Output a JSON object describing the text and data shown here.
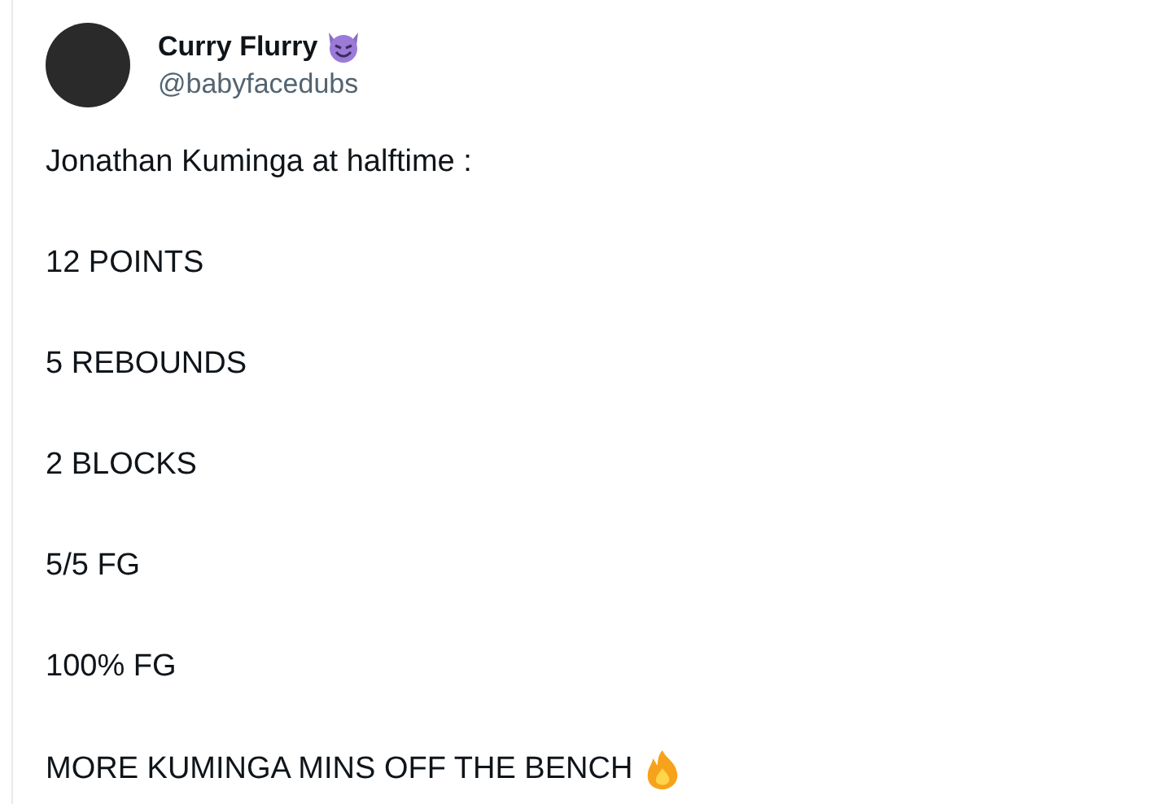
{
  "author": {
    "name": "Curry Flurry",
    "handle": "@babyfacedubs"
  },
  "paragraphs": [
    "Jonathan Kuminga at halftime :",
    "12 POINTS",
    "5 REBOUNDS",
    "2 BLOCKS",
    "5/5 FG",
    "100% FG",
    "MORE KUMINGA MINS OFF THE BENCH"
  ]
}
